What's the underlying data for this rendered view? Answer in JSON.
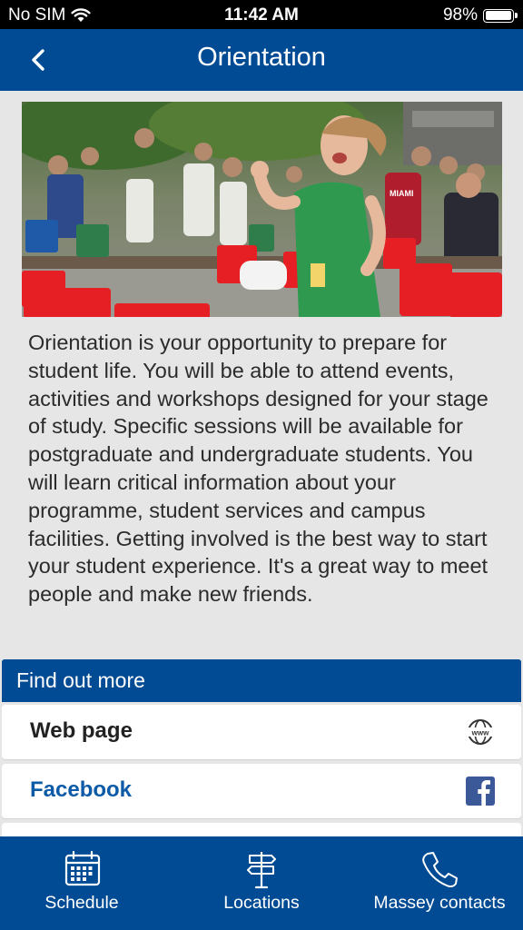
{
  "status_bar": {
    "carrier": "No SIM",
    "time": "11:42 AM",
    "battery": "98%",
    "battery_level": 0.98,
    "wifi_icon": "wifi-icon",
    "battery_icon": "battery-icon"
  },
  "nav": {
    "title": "Orientation",
    "back_icon": "chevron-left-icon"
  },
  "hero": {
    "image": "orientation-students-photo",
    "jersey_text": "MIAMI"
  },
  "intro_text": "Orientation is your opportunity to prepare for student life. You will be able to attend events, activities and workshops designed for your stage of study. Specific sessions will be available for postgraduate and undergraduate students. You will learn critical information about your programme, student services and campus facilities. Getting involved is the best way to start your student experience. It's a great way to meet people and make new friends.",
  "find_out_more": {
    "header": "Find out more",
    "links": [
      {
        "label": "Web page",
        "icon": "globe-www-icon"
      },
      {
        "label": "Facebook",
        "icon": "facebook-icon"
      }
    ]
  },
  "tab_bar": {
    "tabs": [
      {
        "label": "Schedule",
        "icon": "calendar-icon"
      },
      {
        "label": "Locations",
        "icon": "signpost-icon"
      },
      {
        "label": "Massey contacts",
        "icon": "phone-icon"
      }
    ]
  },
  "colors": {
    "brand_blue": "#004b93",
    "facebook_blue": "#0d5aa7",
    "page_background": "#e6e6e6"
  }
}
